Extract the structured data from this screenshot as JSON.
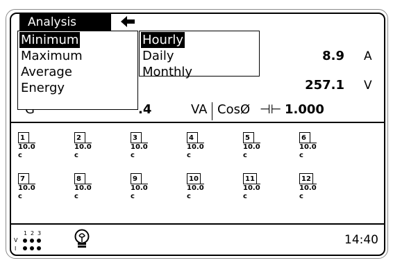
{
  "screen": {
    "title": "Analysis",
    "back_glyph": "🡐",
    "menu_primary": [
      "Minimum",
      "Maximum",
      "Average",
      "Energy"
    ],
    "menu_primary_selected": 0,
    "menu_secondary": [
      "Hourly",
      "Daily",
      "Monthly"
    ],
    "menu_secondary_selected": 0,
    "readings": [
      {
        "value": "8.9",
        "unit": "A"
      },
      {
        "value": "257.1",
        "unit": "V"
      }
    ],
    "row3": {
      "partial_left": "G",
      "partial_value": ".4",
      "unit": "VA",
      "cos_label": "CosØ",
      "cap_glyph": "⊣⊢",
      "cos_value": "1.000"
    },
    "cells": [
      {
        "id": "1",
        "value": "10.0",
        "phase": "c"
      },
      {
        "id": "2",
        "value": "10.0",
        "phase": "c"
      },
      {
        "id": "3",
        "value": "10.0",
        "phase": "c"
      },
      {
        "id": "4",
        "value": "10.0",
        "phase": "c"
      },
      {
        "id": "5",
        "value": "10.0",
        "phase": "c"
      },
      {
        "id": "6",
        "value": "10.0",
        "phase": "c"
      },
      {
        "id": "7",
        "value": "10.0",
        "phase": "c"
      },
      {
        "id": "8",
        "value": "10.0",
        "phase": "c"
      },
      {
        "id": "9",
        "value": "10.0",
        "phase": "c"
      },
      {
        "id": "10",
        "value": "10.0",
        "phase": "c"
      },
      {
        "id": "11",
        "value": "10.0",
        "phase": "c"
      },
      {
        "id": "12",
        "value": "10.0",
        "phase": "c"
      }
    ],
    "status": {
      "v_label": "V",
      "i_label": "I",
      "phase_labels": [
        "1",
        "2",
        "3"
      ],
      "bulb_icon": "lightbulb-icon",
      "time": "14:40"
    }
  }
}
